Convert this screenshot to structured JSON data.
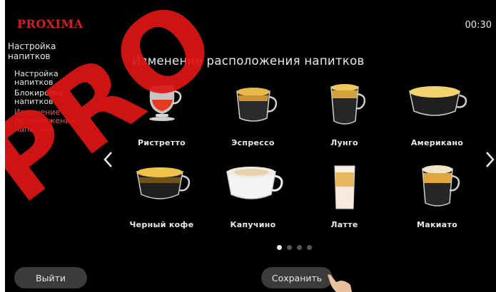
{
  "brand": {
    "logo": "PROXIMA",
    "logo_color": "#d21f1f"
  },
  "clock": "00:30",
  "sidebar": {
    "title": "Настройка напитков",
    "items": [
      {
        "label": "Настройка напитков",
        "active": false
      },
      {
        "label": "Блокировка напитков",
        "active": false
      },
      {
        "label": "Изменение расположения напитков",
        "active": true
      }
    ]
  },
  "main": {
    "title": "Изменение расположения напитков",
    "drinks": [
      {
        "label": "Ристретто",
        "icon": "ristretto-cup-icon"
      },
      {
        "label": "Эспрессо",
        "icon": "espresso-cup-icon"
      },
      {
        "label": "Лунго",
        "icon": "lungo-cup-icon"
      },
      {
        "label": "Американо",
        "icon": "americano-cup-icon"
      },
      {
        "label": "Черный кофе",
        "icon": "black-coffee-cup-icon"
      },
      {
        "label": "Капучино",
        "icon": "cappuccino-cup-icon"
      },
      {
        "label": "Латте",
        "icon": "latte-glass-icon"
      },
      {
        "label": "Макиато",
        "icon": "macchiato-cup-icon"
      }
    ],
    "pagination": {
      "pages": 4,
      "current": 1
    }
  },
  "buttons": {
    "exit": "Выйти",
    "save": "Сохранить"
  },
  "watermark": {
    "text": "PROXIMA",
    "color": "#e01515"
  },
  "colors": {
    "accent": "#e45a5a",
    "button_bg": "#3b3b3b",
    "background": "#000000"
  }
}
